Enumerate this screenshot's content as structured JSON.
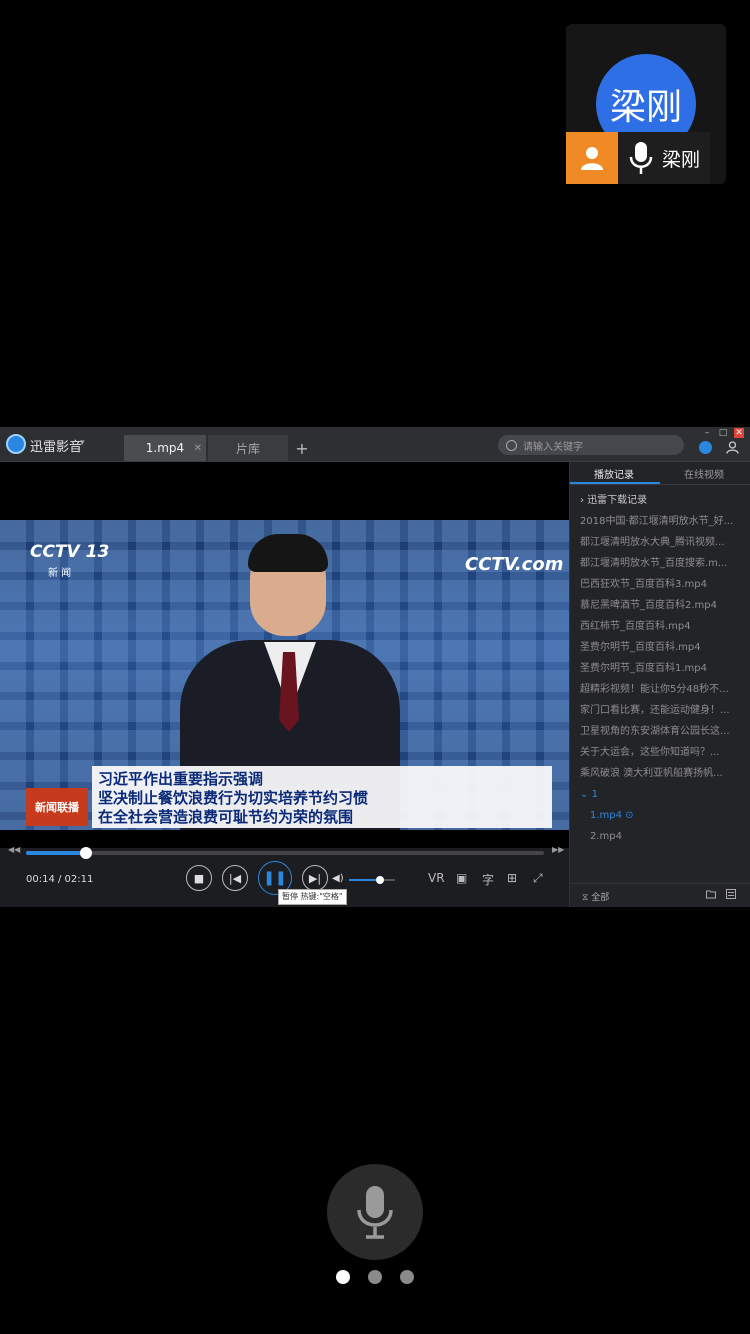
{
  "caller": {
    "avatar_text": "梁刚",
    "name": "梁刚"
  },
  "player": {
    "app_name": "迅雷影音",
    "tabs": [
      {
        "label": "1.mp4",
        "active": true
      },
      {
        "label": "片库",
        "active": false
      }
    ],
    "add_tab": "+",
    "search_placeholder": "请输入关键字",
    "video": {
      "channel_logo": "CCTV 13",
      "channel_sub": "新 闻",
      "watermark": "CCTV.com",
      "program_badge": "新闻联播",
      "headline": [
        "习近平作出重要指示强调",
        "坚决制止餐饮浪费行为切实培养节约习惯",
        "在全社会营造浪费可耻节约为荣的氛围"
      ]
    },
    "controls": {
      "time": "00:14 / 02:11",
      "progress": 0.116,
      "volume": 0.68,
      "right_buttons": [
        "VR",
        "▣",
        "字",
        "⊞",
        "⤢"
      ],
      "tooltip": "暂停 热键:\"空格\""
    },
    "sidebar": {
      "tabs": [
        "播放记录",
        "在线视频"
      ],
      "folder": "迅雷下载记录",
      "items": [
        "2018中国·都江堰清明放水节_好...",
        "都江堰清明放水大典_腾讯视频...",
        "都江堰清明放水节_百度搜索.m...",
        "巴西狂欢节_百度百科3.mp4",
        "慕尼黑啤酒节_百度百科2.mp4",
        "西红柿节_百度百科.mp4",
        "圣费尔明节_百度百科.mp4",
        "圣费尔明节_百度百科1.mp4",
        "超精彩视频！能让你5分48秒不...",
        "家门口看比赛，还能运动健身！...",
        "卫星视角的东安湖体育公园长这...",
        "关于大运会，这些你知道吗？...",
        "乘风破浪 澳大利亚帆船赛扬帆..."
      ],
      "group": "1",
      "group_items": [
        "1.mp4",
        "2.mp4"
      ],
      "footer_label": "全部"
    }
  },
  "pager": {
    "count": 3,
    "active": 0
  },
  "colors": {
    "accent": "#2a87e0",
    "caller_avatar": "#2f6fe6",
    "caller_person": "#f08a24"
  }
}
